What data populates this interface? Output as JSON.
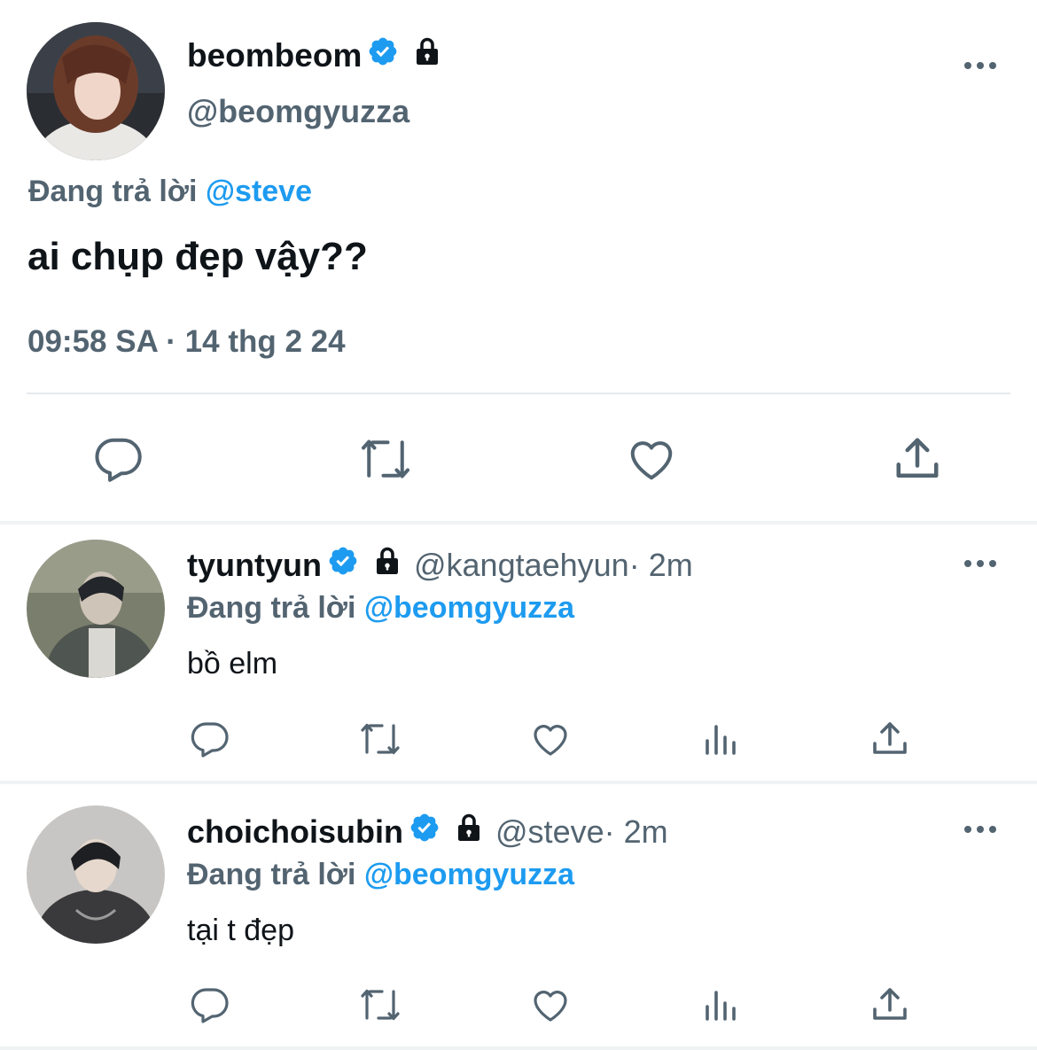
{
  "main_tweet": {
    "display_name": "beombeom",
    "handle": "@beomgyuzza",
    "replying_prefix": "Đang trả lời ",
    "replying_to": "@steve",
    "text": "ai chụp đẹp vậy??",
    "timestamp": "09:58 SA · 14 thg 2 24",
    "verified_color": "#1d9bf0",
    "icons": [
      "verified-badge-icon",
      "lock-icon",
      "more-icon",
      "reply-icon",
      "retweet-icon",
      "like-icon",
      "share-icon"
    ]
  },
  "replies": [
    {
      "display_name": "tyuntyun",
      "handle": "@kangtaehyun",
      "time": " · 2m",
      "replying_prefix": "Đang trả lời ",
      "replying_to": "@beomgyuzza",
      "text": "bồ elm"
    },
    {
      "display_name": "choichoisubin",
      "handle": "@steve",
      "time": " · 2m",
      "replying_prefix": "Đang trả lời ",
      "replying_to": "@beomgyuzza",
      "text": "tại t đẹp"
    }
  ],
  "colors": {
    "accent": "#1d9bf0",
    "muted_text": "#536471",
    "icon_gray": "#536471"
  }
}
